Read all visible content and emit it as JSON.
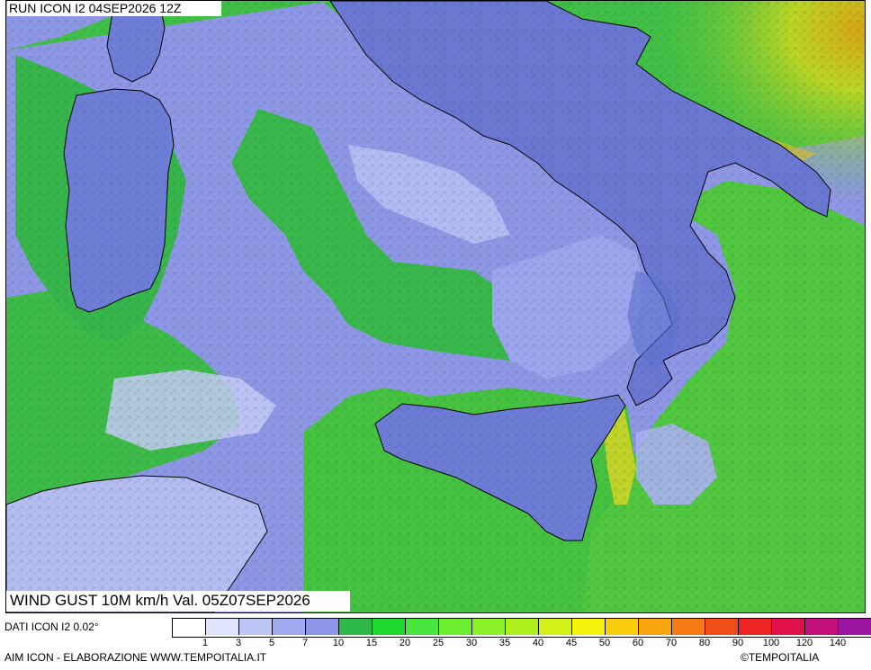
{
  "header": {
    "run_label": "RUN ICON I2 04SEP2026 12Z",
    "valid_label": "WIND GUST 10M km/h Val. 05Z07SEP2026"
  },
  "footer": {
    "dati_label": "DATI ICON I2 0.02°",
    "aim_label": "AIM ICON - ELABORAZIONE WWW.TEMPOITALIA.IT",
    "copyright_label": "©TEMPOITALIA"
  },
  "legend": {
    "unit": "km/h",
    "colors": [
      "#ffffff",
      "#dfe3fb",
      "#bec6f6",
      "#a0aaf0",
      "#8c96e6",
      "#2fb84a",
      "#1ed82e",
      "#46e63a",
      "#6aee2e",
      "#8cf028",
      "#aef01e",
      "#d2f018",
      "#f7f20e",
      "#f9cc0e",
      "#f7a40e",
      "#f57a14",
      "#f04e18",
      "#ec2424",
      "#e0104a",
      "#c40e7a",
      "#9a14a0",
      "#661066"
    ],
    "tick_labels": [
      "1",
      "3",
      "5",
      "7",
      "10",
      "15",
      "20",
      "25",
      "30",
      "35",
      "40",
      "45",
      "50",
      "60",
      "70",
      "80",
      "90",
      "100",
      "120",
      "140"
    ]
  }
}
